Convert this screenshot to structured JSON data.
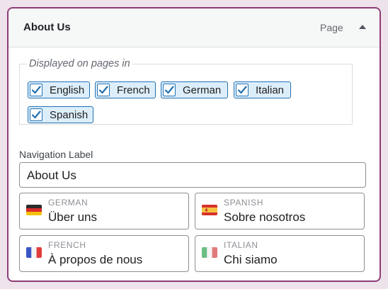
{
  "panel": {
    "title": "About Us",
    "type_label": "Page"
  },
  "pages": {
    "legend": "Displayed on pages in",
    "languages": [
      {
        "label": "English",
        "checked": true
      },
      {
        "label": "French",
        "checked": true
      },
      {
        "label": "German",
        "checked": true
      },
      {
        "label": "Italian",
        "checked": true
      },
      {
        "label": "Spanish",
        "checked": true
      }
    ]
  },
  "navigation": {
    "label": "Navigation Label",
    "value": "About Us"
  },
  "translations": [
    {
      "language": "GERMAN",
      "value": "Über uns",
      "flag": "german-flag"
    },
    {
      "language": "SPANISH",
      "value": "Sobre nosotros",
      "flag": "spanish-flag"
    },
    {
      "language": "FRENCH",
      "value": "À propos de nous",
      "flag": "french-flag"
    },
    {
      "language": "ITALIAN",
      "value": "Chi siamo",
      "flag": "italian-flag"
    }
  ],
  "colors": {
    "accent": "#2271b1",
    "panel_border": "#8e3b78",
    "chip_background": "#ddeefb",
    "page_background": "#eee3ea"
  }
}
